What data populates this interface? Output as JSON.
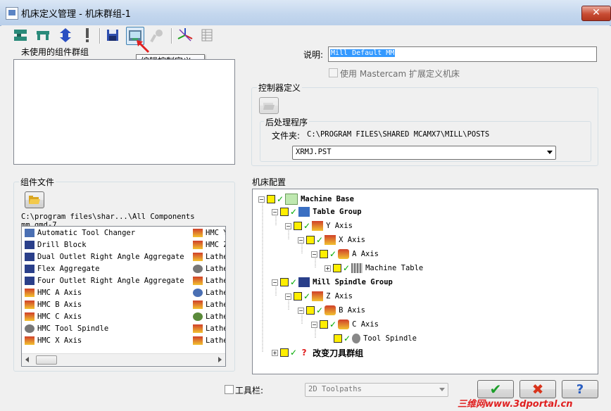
{
  "window": {
    "title": "机床定义管理 - 机床群组-1",
    "close_label": "✕"
  },
  "toolbar": {
    "tooltip": "编辑控制定义。"
  },
  "unused_groups": {
    "label": "未使用的组件群组"
  },
  "description": {
    "label": "说明:",
    "value": "Mill Default MM"
  },
  "extend_checkbox": {
    "label": "使用 Mastercam 扩展定义机床"
  },
  "controller": {
    "label": "控制器定义"
  },
  "post": {
    "label": "后处理程序",
    "folder_label": "文件夹:",
    "folder_path": "C:\\PROGRAM FILES\\SHARED MCAMX7\\MILL\\POSTS",
    "selected_post": "XRMJ.PST"
  },
  "component_files": {
    "label": "组件文件",
    "path": "C:\\program files\\shar...\\All Components mm.gmd-7",
    "col1": [
      "Automatic Tool Changer",
      "Drill Block",
      "Dual Outlet Right Angle Aggregate",
      "Flex Aggregate",
      "Four Outlet Right Angle Aggregate",
      "HMC A Axis",
      "HMC B Axis",
      "HMC C Axis",
      "HMC Tool Spindle",
      "HMC X Axis"
    ],
    "col2": [
      "HMC Y",
      "HMC Z",
      "Lathe",
      "Lathe",
      "Lathe",
      "Lathe",
      "Lathe",
      "Lathe",
      "Lathe",
      "Lathe"
    ]
  },
  "machine_config": {
    "label": "机床配置",
    "nodes": [
      "Machine Base",
      "Table Group",
      "Y Axis",
      "X Axis",
      "A Axis",
      "Machine Table",
      "Mill Spindle Group",
      "Z Axis",
      "B Axis",
      "C Axis",
      "Tool Spindle",
      "改变刀具群组"
    ]
  },
  "bottom": {
    "toolbar_label": "工具栏:",
    "toolpaths_value": "2D Toolpaths",
    "ok_icon": "✔",
    "cancel_icon": "✖",
    "help_icon": "?"
  },
  "watermark": "三维网www.3dportal.cn"
}
